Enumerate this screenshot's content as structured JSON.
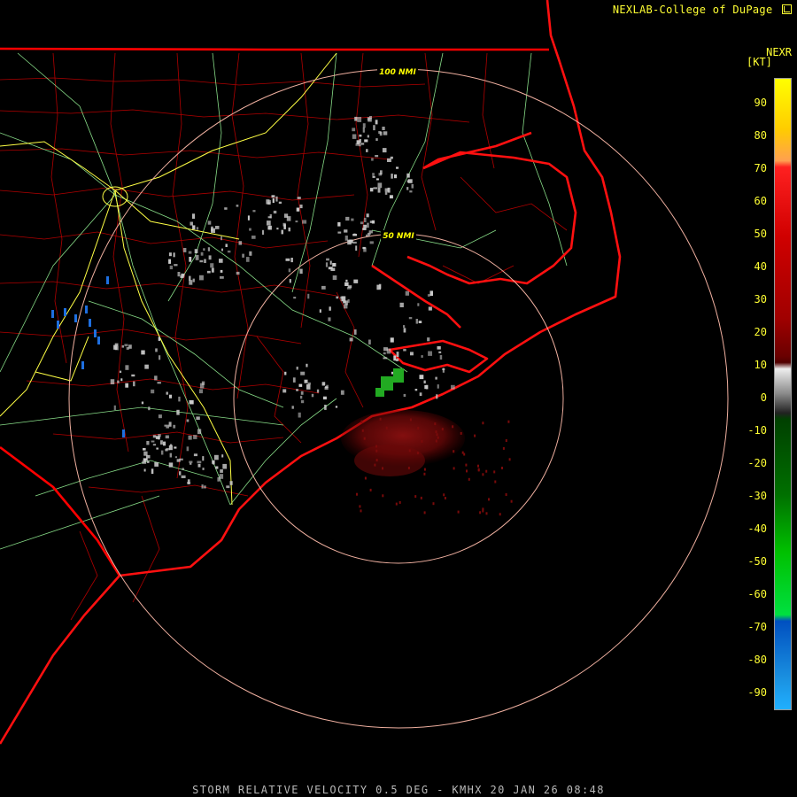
{
  "header": {
    "credit": "NEXLAB-College of DuPage",
    "credit_logo": "dupage-logo-icon"
  },
  "map": {
    "range_rings": [
      "100 NMI",
      "50 NMI"
    ],
    "colors": {
      "background": "#000000",
      "state_borders": "#ff0000",
      "county_borders": "#b00000",
      "highways": "#88dd88",
      "interstates": "#ffff44",
      "range_rings": "#f0b0a0"
    }
  },
  "scale": {
    "product": "NEXR",
    "unit": "[KT]",
    "ticks": [
      "90",
      "80",
      "70",
      "60",
      "50",
      "40",
      "30",
      "20",
      "10",
      "0",
      "-10",
      "-20",
      "-30",
      "-40",
      "-50",
      "-60",
      "-70",
      "-80",
      "-90"
    ]
  },
  "footer": {
    "caption": "STORM RELATIVE VELOCITY 0.5 DEG - KMHX 20 JAN 26 08:48"
  }
}
